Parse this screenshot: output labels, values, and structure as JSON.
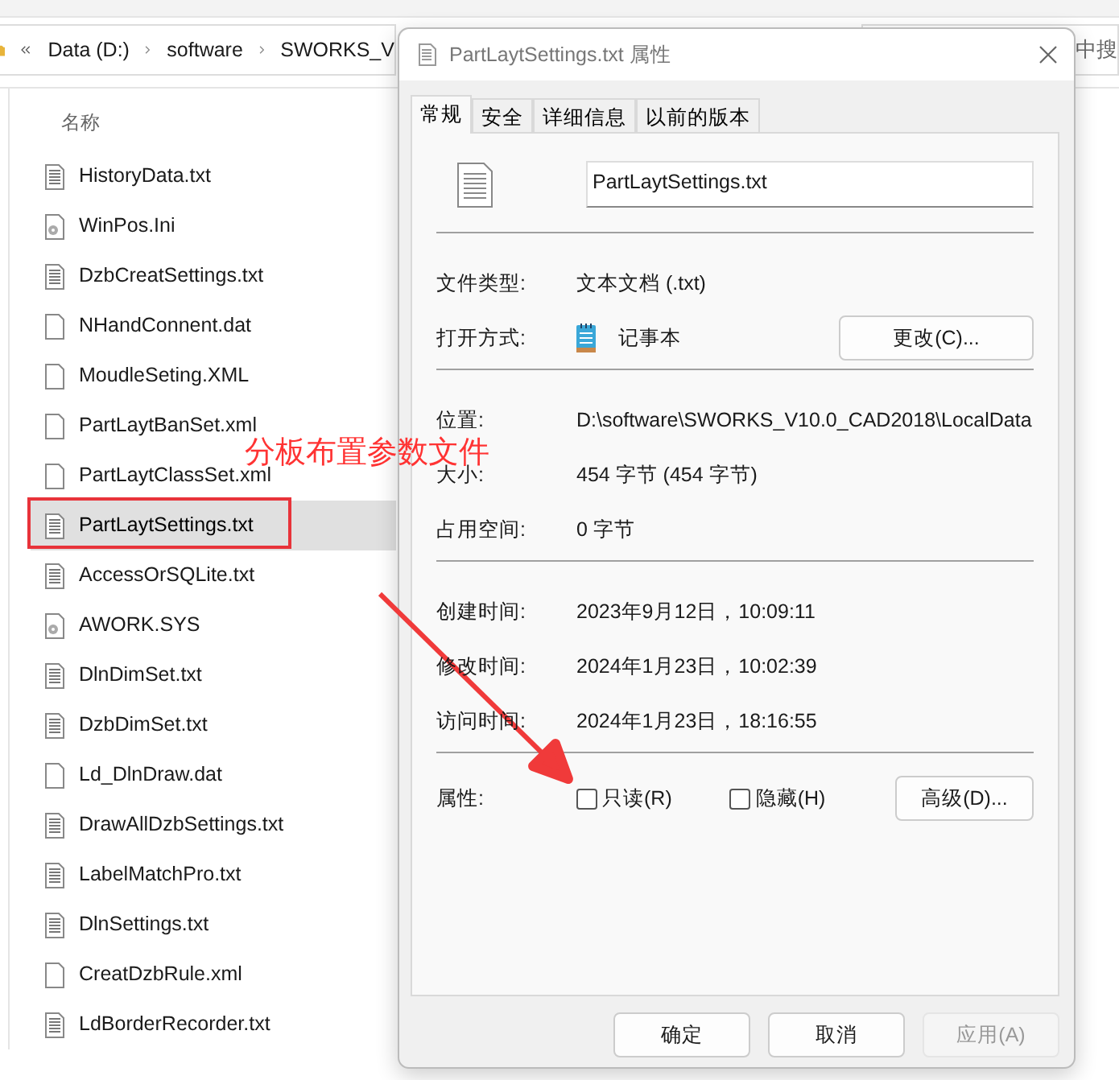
{
  "explorer": {
    "breadcrumb": [
      "Data (D:)",
      "software",
      "SWORKS_V"
    ],
    "search": {
      "placeholder": "中搜"
    },
    "column_header": "名称",
    "files": [
      {
        "name": "HistoryData.txt",
        "kind": "text",
        "selected": false
      },
      {
        "name": "WinPos.Ini",
        "kind": "config",
        "selected": false
      },
      {
        "name": "DzbCreatSettings.txt",
        "kind": "text",
        "selected": false
      },
      {
        "name": "NHandConnent.dat",
        "kind": "blank",
        "selected": false
      },
      {
        "name": "MoudleSeting.XML",
        "kind": "blank",
        "selected": false
      },
      {
        "name": "PartLaytBanSet.xml",
        "kind": "blank",
        "selected": false
      },
      {
        "name": "PartLaytClassSet.xml",
        "kind": "blank",
        "selected": false
      },
      {
        "name": "PartLaytSettings.txt",
        "kind": "text",
        "selected": true
      },
      {
        "name": "AccessOrSQLite.txt",
        "kind": "text",
        "selected": false
      },
      {
        "name": "AWORK.SYS",
        "kind": "config",
        "selected": false
      },
      {
        "name": "DlnDimSet.txt",
        "kind": "text",
        "selected": false
      },
      {
        "name": "DzbDimSet.txt",
        "kind": "text",
        "selected": false
      },
      {
        "name": "Ld_DlnDraw.dat",
        "kind": "blank",
        "selected": false
      },
      {
        "name": "DrawAllDzbSettings.txt",
        "kind": "text",
        "selected": false
      },
      {
        "name": "LabelMatchPro.txt",
        "kind": "text",
        "selected": false
      },
      {
        "name": "DlnSettings.txt",
        "kind": "text",
        "selected": false
      },
      {
        "name": "CreatDzbRule.xml",
        "kind": "blank",
        "selected": false
      },
      {
        "name": "LdBorderRecorder.txt",
        "kind": "text",
        "selected": false
      }
    ]
  },
  "annotation": {
    "text": "分板布置参数文件"
  },
  "dialog": {
    "title": "PartLaytSettings.txt 属性",
    "tabs": [
      {
        "label": "常规",
        "selected": true
      },
      {
        "label": "安全",
        "selected": false
      },
      {
        "label": "详细信息",
        "selected": false
      },
      {
        "label": "以前的版本",
        "selected": false
      }
    ],
    "file_name": "PartLaytSettings.txt",
    "sections": [
      [
        {
          "label": "文件类型:",
          "value": "文本文档 (.txt)"
        },
        {
          "label": "打开方式:",
          "value": "记事本",
          "kind": "app",
          "button": "更改(C)..."
        }
      ],
      [
        {
          "label": "位置:",
          "value": "D:\\software\\SWORKS_V10.0_CAD2018\\LocalData"
        },
        {
          "label": "大小:",
          "value": "454 字节 (454 字节)"
        },
        {
          "label": "占用空间:",
          "value": "0 字节"
        }
      ],
      [
        {
          "label": "创建时间:",
          "value": "2023年9月12日，10:09:11"
        },
        {
          "label": "修改时间:",
          "value": "2024年1月23日，10:02:39"
        },
        {
          "label": "访问时间:",
          "value": "2024年1月23日，18:16:55"
        }
      ]
    ],
    "attributes": {
      "label": "属性:",
      "checkboxes": [
        {
          "label": "只读(R)",
          "checked": false
        },
        {
          "label": "隐藏(H)",
          "checked": false
        }
      ],
      "button": "高级(D)..."
    },
    "buttons": [
      {
        "label": "确定",
        "disabled": false
      },
      {
        "label": "取消",
        "disabled": false
      },
      {
        "label": "应用(A)",
        "disabled": true
      }
    ]
  }
}
